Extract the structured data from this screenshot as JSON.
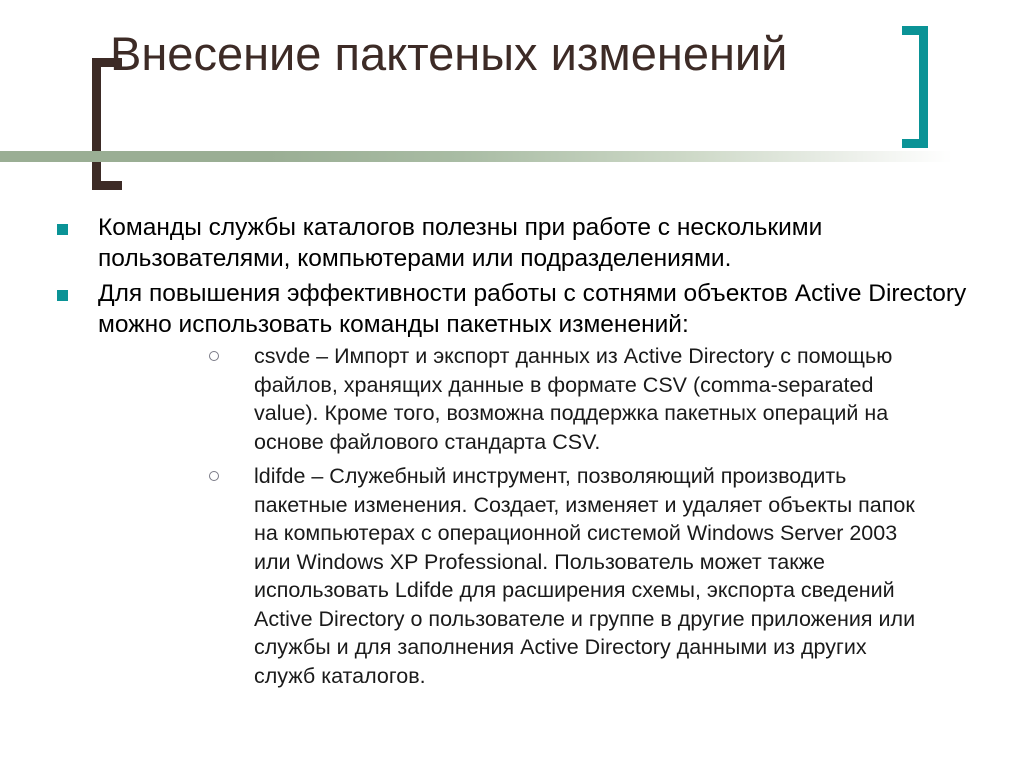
{
  "slide": {
    "title": "Внесение пактеных изменений",
    "title_line_1": "Внесение пактеных",
    "title_line_2": "изменений",
    "colors": {
      "title_text": "#3d2b26",
      "left_bracket": "#3d2b26",
      "right_bracket": "#0a9396",
      "bullet_square": "#0a9396",
      "rule_gradient_start": "#9aae94",
      "rule_gradient_end": "#ffffff",
      "body_text": "#000000",
      "sub_bullet_ring": "#7a7a86",
      "background": "#ffffff"
    },
    "decorations": {
      "left_bracket": "left-square-bracket",
      "right_bracket": "right-square-bracket",
      "divider": "gradient-rule"
    }
  },
  "content": {
    "bullets": [
      {
        "marker": "square-bullet",
        "text": "Команды службы каталогов полезны при работе с несколькими пользователями, компьютерами или подразделениями.",
        "sub_bullets": []
      },
      {
        "marker": "square-bullet",
        "text": "Для повышения эффективности работы с сотнями объектов Active Directory можно использовать команды пакетных изменений:",
        "sub_bullets": [
          {
            "marker": "ring-bullet",
            "text": "csvde – Импорт и экспорт данных из Active Directory с помощью файлов, хранящих данные в формате CSV (comma-separated value). Кроме того, возможна поддержка пакетных операций на основе файлового стандарта CSV."
          },
          {
            "marker": "ring-bullet",
            "text": "ldifde – Служебный инструмент, позволяющий производить пакетные изменения. Создает, изменяет и удаляет объекты папок на компьютерах с операционной системой Windows Server 2003 или Windows XP Professional. Пользователь может также использовать Ldifde для расширения схемы, экспорта сведений Active Directory о пользователе и группе в другие приложения или службы и для заполнения Active Directory данными из других служб каталогов."
          }
        ]
      }
    ]
  }
}
